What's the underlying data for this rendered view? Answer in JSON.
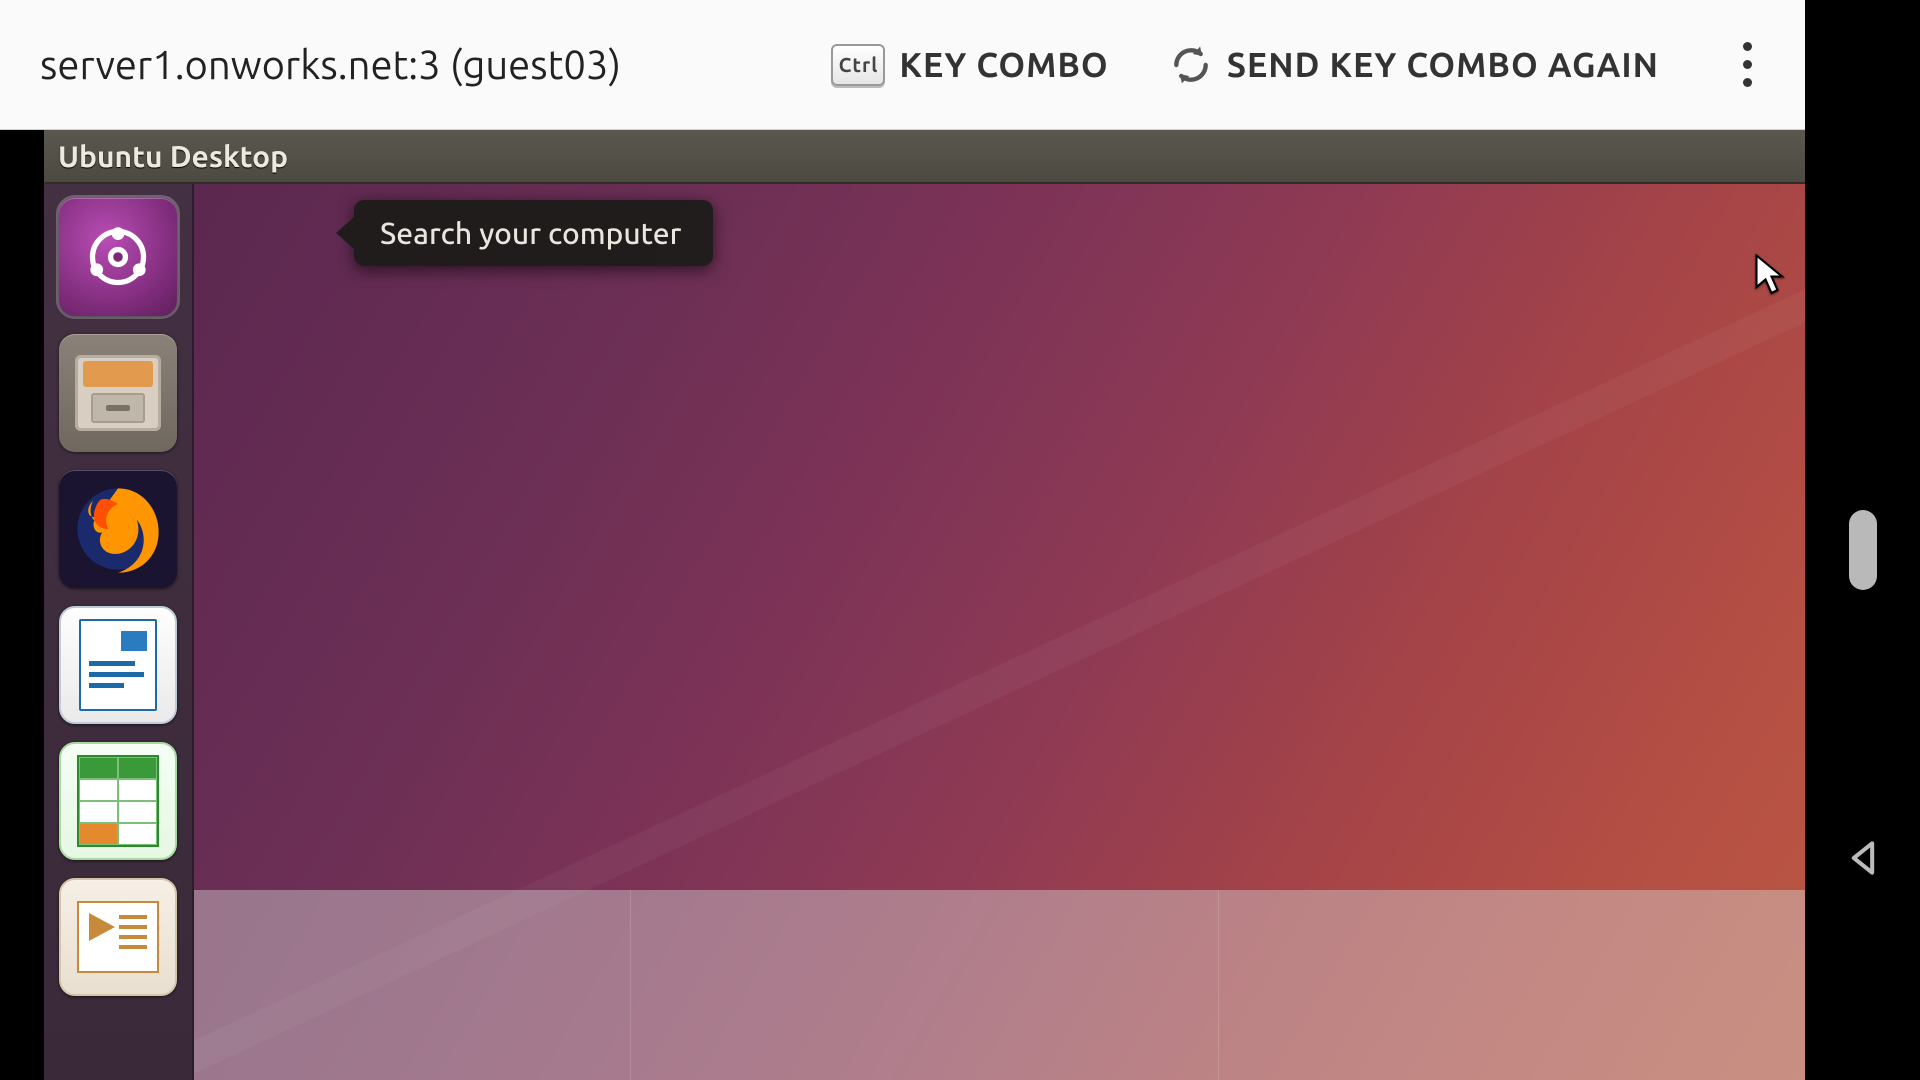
{
  "hostbar": {
    "title": "server1.onworks.net:3 (guest03)",
    "key_combo_label": "KEY COMBO",
    "ctrl_key_label": "Ctrl",
    "send_again_label": "SEND KEY COMBO AGAIN"
  },
  "unity": {
    "panel_title": "Ubuntu Desktop",
    "tooltip": "Search your computer",
    "launcher": [
      {
        "name": "dash",
        "label": "Search your computer",
        "selected": true
      },
      {
        "name": "files",
        "label": "Files",
        "selected": false
      },
      {
        "name": "firefox",
        "label": "Firefox Web Browser",
        "selected": false
      },
      {
        "name": "writer",
        "label": "LibreOffice Writer",
        "selected": false
      },
      {
        "name": "calc",
        "label": "LibreOffice Calc",
        "selected": false
      },
      {
        "name": "impress",
        "label": "LibreOffice Impress",
        "selected": false
      }
    ]
  },
  "colors": {
    "ubuntu_purple": "#5b2850",
    "ubuntu_orange": "#e95420",
    "panel_bg": "#4d4a42"
  }
}
